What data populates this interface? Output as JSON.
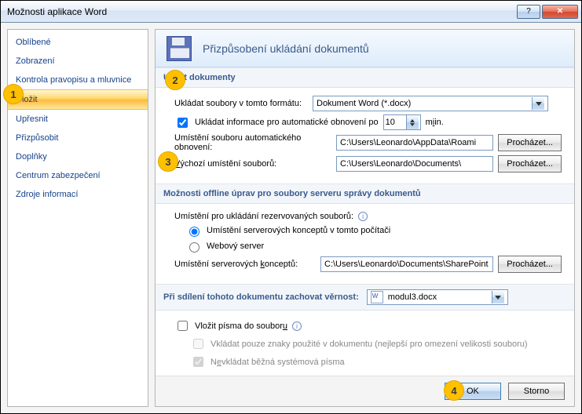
{
  "window": {
    "title": "Možnosti aplikace Word"
  },
  "sidebar": {
    "items": [
      {
        "label": "Oblíbené"
      },
      {
        "label": "Zobrazení"
      },
      {
        "label": "Kontrola pravopisu a mluvnice"
      },
      {
        "label": "Uložit",
        "selected": true
      },
      {
        "label": "Upřesnit"
      },
      {
        "label": "Přizpůsobit"
      },
      {
        "label": "Doplňky"
      },
      {
        "label": "Centrum zabezpečení"
      },
      {
        "label": "Zdroje informací"
      }
    ]
  },
  "header": {
    "title": "Přizpůsobení ukládání dokumentů"
  },
  "save_section": {
    "heading": "Uložit dokumenty",
    "format_label": "Ukládat soubory v tomto formátu:",
    "format_value": "Dokument Word (*.docx)",
    "autorecover_checkbox": "Ukládat informace pro automatické obnovení po",
    "autorecover_checked": true,
    "autorecover_minutes": "10",
    "autorecover_unit_pre": "m",
    "autorecover_unit_post": "in.",
    "autorecover_unit_ul": "i",
    "ar_loc_label": "Umístění souboru automatického obnovení:",
    "ar_loc_value": "C:\\Users\\Leonardo\\AppData\\Roami",
    "default_loc_label_pre": "V",
    "default_loc_label_post": "ýchozí umístění souborů:",
    "default_loc_value": "C:\\Users\\Leonardo\\Documents\\",
    "browse_label": "Procházet..."
  },
  "offline_section": {
    "heading": "Možnosti offline úprav pro soubory serveru správy dokumentů",
    "reserved_label": "Umístění pro ukládání rezervovaných souborů:",
    "radio1": "Umístění serverových konceptů v tomto počítači",
    "radio2": "Webový server",
    "radio_selected": 0,
    "drafts_label_pre": "Umístění serverových ",
    "drafts_label_ul": "k",
    "drafts_label_post": "onceptů:",
    "drafts_value": "C:\\Users\\Leonardo\\Documents\\SharePoint",
    "browse_label": "Procházet..."
  },
  "fidelity_section": {
    "heading": "Při sdílení tohoto dokumentu zachovat věrnost:",
    "doc_name": "modul3.docx",
    "embed_checkbox_pre": "Vložit písma do soubor",
    "embed_checkbox_ul": "u",
    "embed_checked": false,
    "sub1": "Vkládat pouze znaky použité v dokumentu (nejlepší pro omezení velikosti souboru)",
    "sub2_pre": "N",
    "sub2_ul": "e",
    "sub2_post": "vkládat běžná systémová písma"
  },
  "footer": {
    "ok": "OK",
    "cancel": "Storno"
  },
  "callouts": {
    "c1": "1",
    "c2": "2",
    "c3": "3",
    "c4": "4"
  }
}
